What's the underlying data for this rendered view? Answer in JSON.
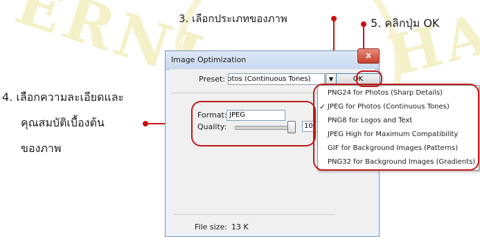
{
  "annotations": {
    "step3": "3. เลือกประเภทของภาพ",
    "step4_line1": "4. เลือกความละเอียดและ",
    "step4_line2": "คุณสมบัติเบื้องต้น",
    "step4_line3": "ของภาพ",
    "step5": "5. คลิกปุ่ม OK"
  },
  "dialog": {
    "title": "Image Optimization",
    "close_glyph": "x",
    "preset_label": "Preset:",
    "preset_value": "hotos (Continuous Tones)",
    "dropdown_arrow": "▼",
    "ok_label": "OK",
    "format_label": "Format:",
    "format_value": "JPEG",
    "quality_label": "Quality:",
    "quality_value": "10",
    "file_size_label": "File size:",
    "file_size_value": "13 K"
  },
  "preset_options": [
    {
      "label": "PNG24 for Photos (Sharp Details)",
      "checked": false
    },
    {
      "label": "JPEG for Photos (Continuous Tones)",
      "checked": true
    },
    {
      "label": "PNG8 for Logos and Text",
      "checked": false
    },
    {
      "label": "JPEG High for Maximum Compatibility",
      "checked": false
    },
    {
      "label": "GIF for Background Images (Patterns)",
      "checked": false
    },
    {
      "label": "PNG32 for Background Images (Gradients)",
      "checked": false
    }
  ],
  "check_glyph": "✓",
  "colors": {
    "highlight": "#c01818",
    "annotation_text": "#1c1c1c",
    "dialog_bg": "#f0f0f0"
  }
}
